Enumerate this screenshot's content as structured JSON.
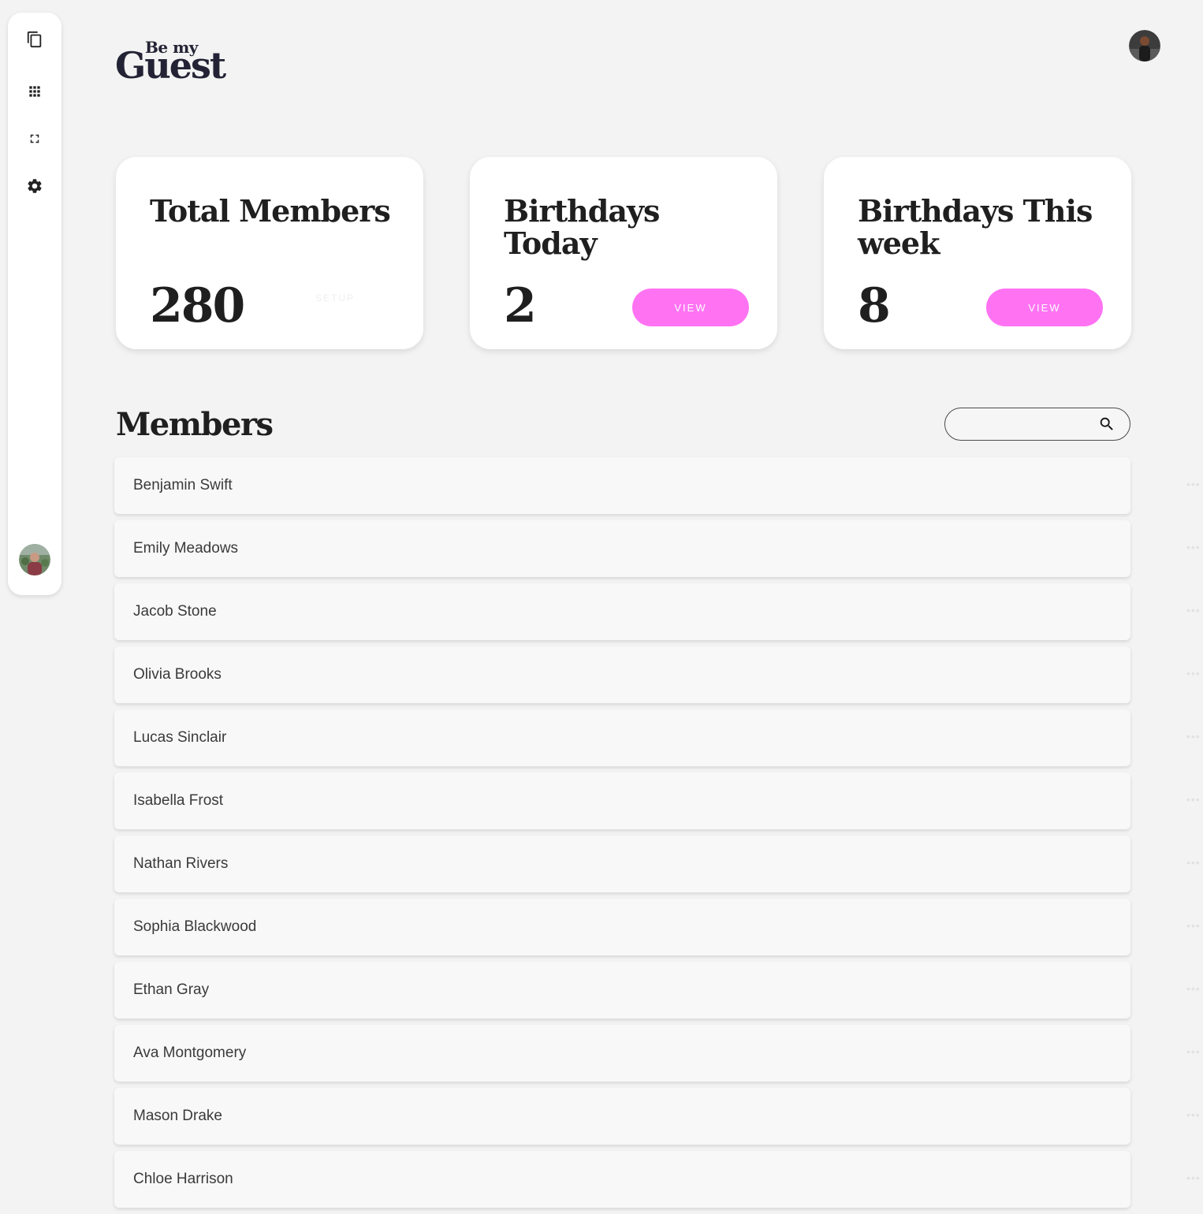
{
  "logo": {
    "small": "Be my",
    "big": "Guest"
  },
  "sidebar": {
    "items": [
      {
        "name": "copy-icon"
      },
      {
        "name": "apps-grid-icon"
      },
      {
        "name": "fullscreen-icon"
      },
      {
        "name": "settings-gear-icon"
      }
    ]
  },
  "stats": {
    "total": {
      "title": "Total Members",
      "value": "280",
      "ghost": "SETUP"
    },
    "today": {
      "title": "Birthdays Today",
      "value": "2",
      "button": "VIEW"
    },
    "week": {
      "title": "Birthdays This week",
      "value": "8",
      "button": "VIEW"
    }
  },
  "members": {
    "title": "Members",
    "search": {
      "placeholder": ""
    },
    "more_label": "•••",
    "list": [
      "Benjamin Swift",
      "Emily Meadows",
      "Jacob Stone",
      "Olivia Brooks",
      "Lucas Sinclair",
      "Isabella Frost",
      "Nathan Rivers",
      "Sophia Blackwood",
      "Ethan Gray",
      "Ava Montgomery",
      "Mason Drake",
      "Chloe Harrison"
    ]
  },
  "colors": {
    "accent": "#ff73f3",
    "background": "#f3f3f3",
    "card": "#ffffff",
    "logo": "#232335"
  }
}
